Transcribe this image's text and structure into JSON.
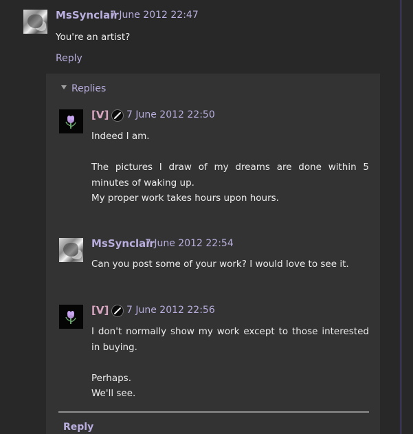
{
  "top_comment": {
    "author": "MsSynclair",
    "timestamp": "7 June 2012 22:47",
    "body": [
      "You're an artist?"
    ],
    "reply_label": "Reply"
  },
  "replies_section": {
    "label": "Replies",
    "items": [
      {
        "author": "[V]",
        "timestamp": "7 June 2012 22:50",
        "body": [
          "Indeed I am.",
          "",
          "The pictures I draw of my dreams are done within 5 minutes of waking up.",
          "My proper work takes hours upon hours."
        ]
      },
      {
        "author": "MsSynclair",
        "timestamp": "7 June 2012 22:54",
        "body": [
          "Can you post some of your work? I would love to see it."
        ]
      },
      {
        "author": "[V]",
        "timestamp": "7 June 2012 22:56",
        "body": [
          "I don't normally show my work except to those interested in buying.",
          "",
          "Perhaps.",
          "We'll see."
        ]
      }
    ],
    "reply_label": "Reply"
  },
  "colors": {
    "background": "#282828",
    "panel": "#333333",
    "accent": "#b9aedd",
    "admin_name": "#d9a6c2",
    "text": "#ececec"
  },
  "icons": {
    "avatar_photo": "avatar-photo",
    "avatar_flower": "flower-avatar",
    "admin_badge": "pencil-icon",
    "replies_toggle": "triangle-down-icon"
  }
}
